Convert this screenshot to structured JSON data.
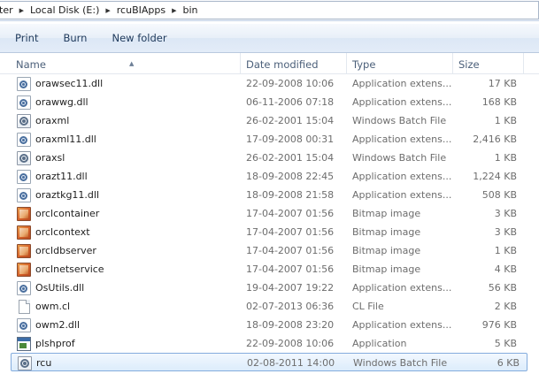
{
  "breadcrumb": {
    "items": [
      "ter",
      "Local Disk (E:)",
      "rcuBIApps",
      "bin"
    ]
  },
  "toolbar": {
    "print_label": "Print",
    "burn_label": "Burn",
    "new_folder_label": "New folder"
  },
  "columns": {
    "name": "Name",
    "date_modified": "Date modified",
    "type": "Type",
    "size": "Size",
    "sorted_by": "Name",
    "sort_direction": "ascending"
  },
  "files": [
    {
      "name": "orawsec11.dll",
      "date": "22-09-2008 10:06",
      "type": "Application extens...",
      "size": "17 KB",
      "icon": "dll-icon"
    },
    {
      "name": "orawwg.dll",
      "date": "06-11-2006 07:18",
      "type": "Application extens...",
      "size": "168 KB",
      "icon": "dll-icon"
    },
    {
      "name": "oraxml",
      "date": "26-02-2001 15:04",
      "type": "Windows Batch File",
      "size": "1 KB",
      "icon": "batch-file-icon"
    },
    {
      "name": "oraxml11.dll",
      "date": "17-09-2008 00:31",
      "type": "Application extens...",
      "size": "2,416 KB",
      "icon": "dll-icon"
    },
    {
      "name": "oraxsl",
      "date": "26-02-2001 15:04",
      "type": "Windows Batch File",
      "size": "1 KB",
      "icon": "batch-file-icon"
    },
    {
      "name": "orazt11.dll",
      "date": "18-09-2008 22:45",
      "type": "Application extens...",
      "size": "1,224 KB",
      "icon": "dll-icon"
    },
    {
      "name": "oraztkg11.dll",
      "date": "18-09-2008 21:58",
      "type": "Application extens...",
      "size": "508 KB",
      "icon": "dll-icon"
    },
    {
      "name": "orclcontainer",
      "date": "17-04-2007 01:56",
      "type": "Bitmap image",
      "size": "3 KB",
      "icon": "bitmap-icon"
    },
    {
      "name": "orclcontext",
      "date": "17-04-2007 01:56",
      "type": "Bitmap image",
      "size": "3 KB",
      "icon": "bitmap-icon"
    },
    {
      "name": "orcldbserver",
      "date": "17-04-2007 01:56",
      "type": "Bitmap image",
      "size": "1 KB",
      "icon": "bitmap-icon"
    },
    {
      "name": "orclnetservice",
      "date": "17-04-2007 01:56",
      "type": "Bitmap image",
      "size": "4 KB",
      "icon": "bitmap-icon"
    },
    {
      "name": "OsUtils.dll",
      "date": "19-04-2007 19:22",
      "type": "Application extens...",
      "size": "56 KB",
      "icon": "dll-icon"
    },
    {
      "name": "owm.cl",
      "date": "02-07-2013 06:36",
      "type": "CL File",
      "size": "2 KB",
      "icon": "file-icon"
    },
    {
      "name": "owm2.dll",
      "date": "18-09-2008 23:20",
      "type": "Application extens...",
      "size": "976 KB",
      "icon": "dll-icon"
    },
    {
      "name": "plshprof",
      "date": "22-09-2008 10:06",
      "type": "Application",
      "size": "5 KB",
      "icon": "application-icon"
    },
    {
      "name": "rcu",
      "date": "02-08-2011 14:00",
      "type": "Windows Batch File",
      "size": "6 KB",
      "icon": "batch-file-icon",
      "selected": true
    }
  ],
  "colors": {
    "selection_border": "#84acdd",
    "selection_fill": "#dcecfc",
    "header_text": "#4c607a",
    "command_text": "#1e395b"
  }
}
